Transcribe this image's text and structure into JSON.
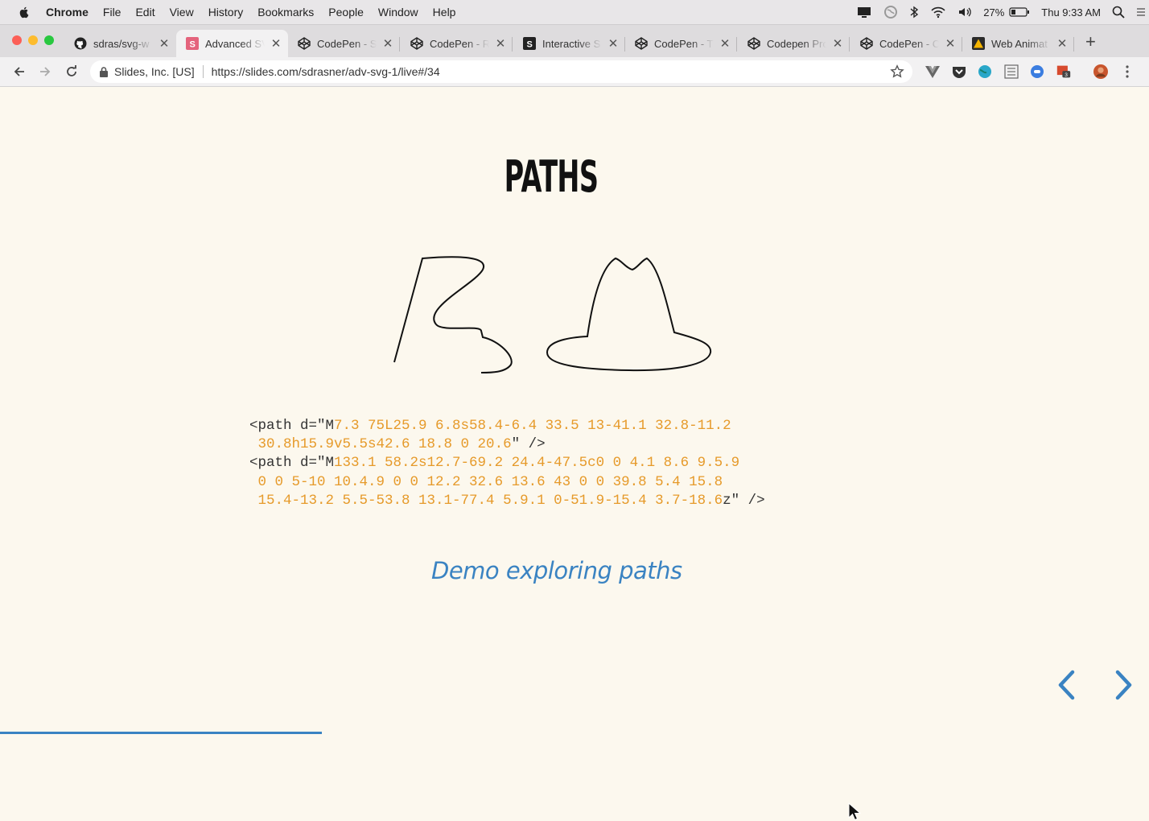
{
  "menubar": {
    "app": "Chrome",
    "items": [
      "File",
      "Edit",
      "View",
      "History",
      "Bookmarks",
      "People",
      "Window",
      "Help"
    ],
    "battery": "27%",
    "clock": "Thu 9:33 AM"
  },
  "tabs": [
    {
      "label": "sdras/svg-w",
      "icon": "github-icon",
      "active": false
    },
    {
      "label": "Advanced SV",
      "icon": "slides-icon",
      "active": true
    },
    {
      "label": "CodePen - S",
      "icon": "codepen-icon",
      "active": false
    },
    {
      "label": "CodePen - R",
      "icon": "codepen-icon",
      "active": false
    },
    {
      "label": "Interactive S",
      "icon": "smashing-icon",
      "active": false
    },
    {
      "label": "CodePen - T",
      "icon": "codepen-icon",
      "active": false
    },
    {
      "label": "Codepen Pro",
      "icon": "codepen-icon",
      "active": false
    },
    {
      "label": "CodePen - C",
      "icon": "codepen-icon",
      "active": false
    },
    {
      "label": "Web Animat",
      "icon": "warning-icon",
      "active": false
    }
  ],
  "omnibox": {
    "site_identity": "Slides, Inc. [US]",
    "url": "https://slides.com/sdrasner/adv-svg-1/live#/34"
  },
  "slide": {
    "title": "PATHS",
    "code_lines": [
      [
        {
          "t": "<path d=\"M",
          "c": "k"
        },
        {
          "t": "7.3 75L25.9 6.8s58.4-6.4 33.5 13-41.1 32.8-11.2",
          "c": "o"
        }
      ],
      [
        {
          "t": " ",
          "c": "k"
        },
        {
          "t": "30.8h15.9v5.5s42.6 18.8 0 20.6",
          "c": "o"
        },
        {
          "t": "\" />",
          "c": "k"
        }
      ],
      [
        {
          "t": "<path d=\"M",
          "c": "k"
        },
        {
          "t": "133.1 58.2s12.7-69.2 24.4-47.5c0 0 4.1 8.6 9.5.9",
          "c": "o"
        }
      ],
      [
        {
          "t": " ",
          "c": "k"
        },
        {
          "t": "0 0 5-10 10.4.9 0 0 12.2 32.6 13.6 43 0 0 39.8 5.4 15.8",
          "c": "o"
        }
      ],
      [
        {
          "t": " ",
          "c": "k"
        },
        {
          "t": "15.4-13.2 5.5-53.8 13.1-77.4 5.9.1 0-51.9-15.4 3.7-18.6",
          "c": "o"
        },
        {
          "t": "z\" />",
          "c": "k"
        }
      ]
    ],
    "demo_link": "Demo exploring paths",
    "progress_fraction": 0.28
  },
  "colors": {
    "slide_bg": "#fcf8ee",
    "code_orange": "#e69a2a",
    "link_blue": "#3a83c2"
  }
}
